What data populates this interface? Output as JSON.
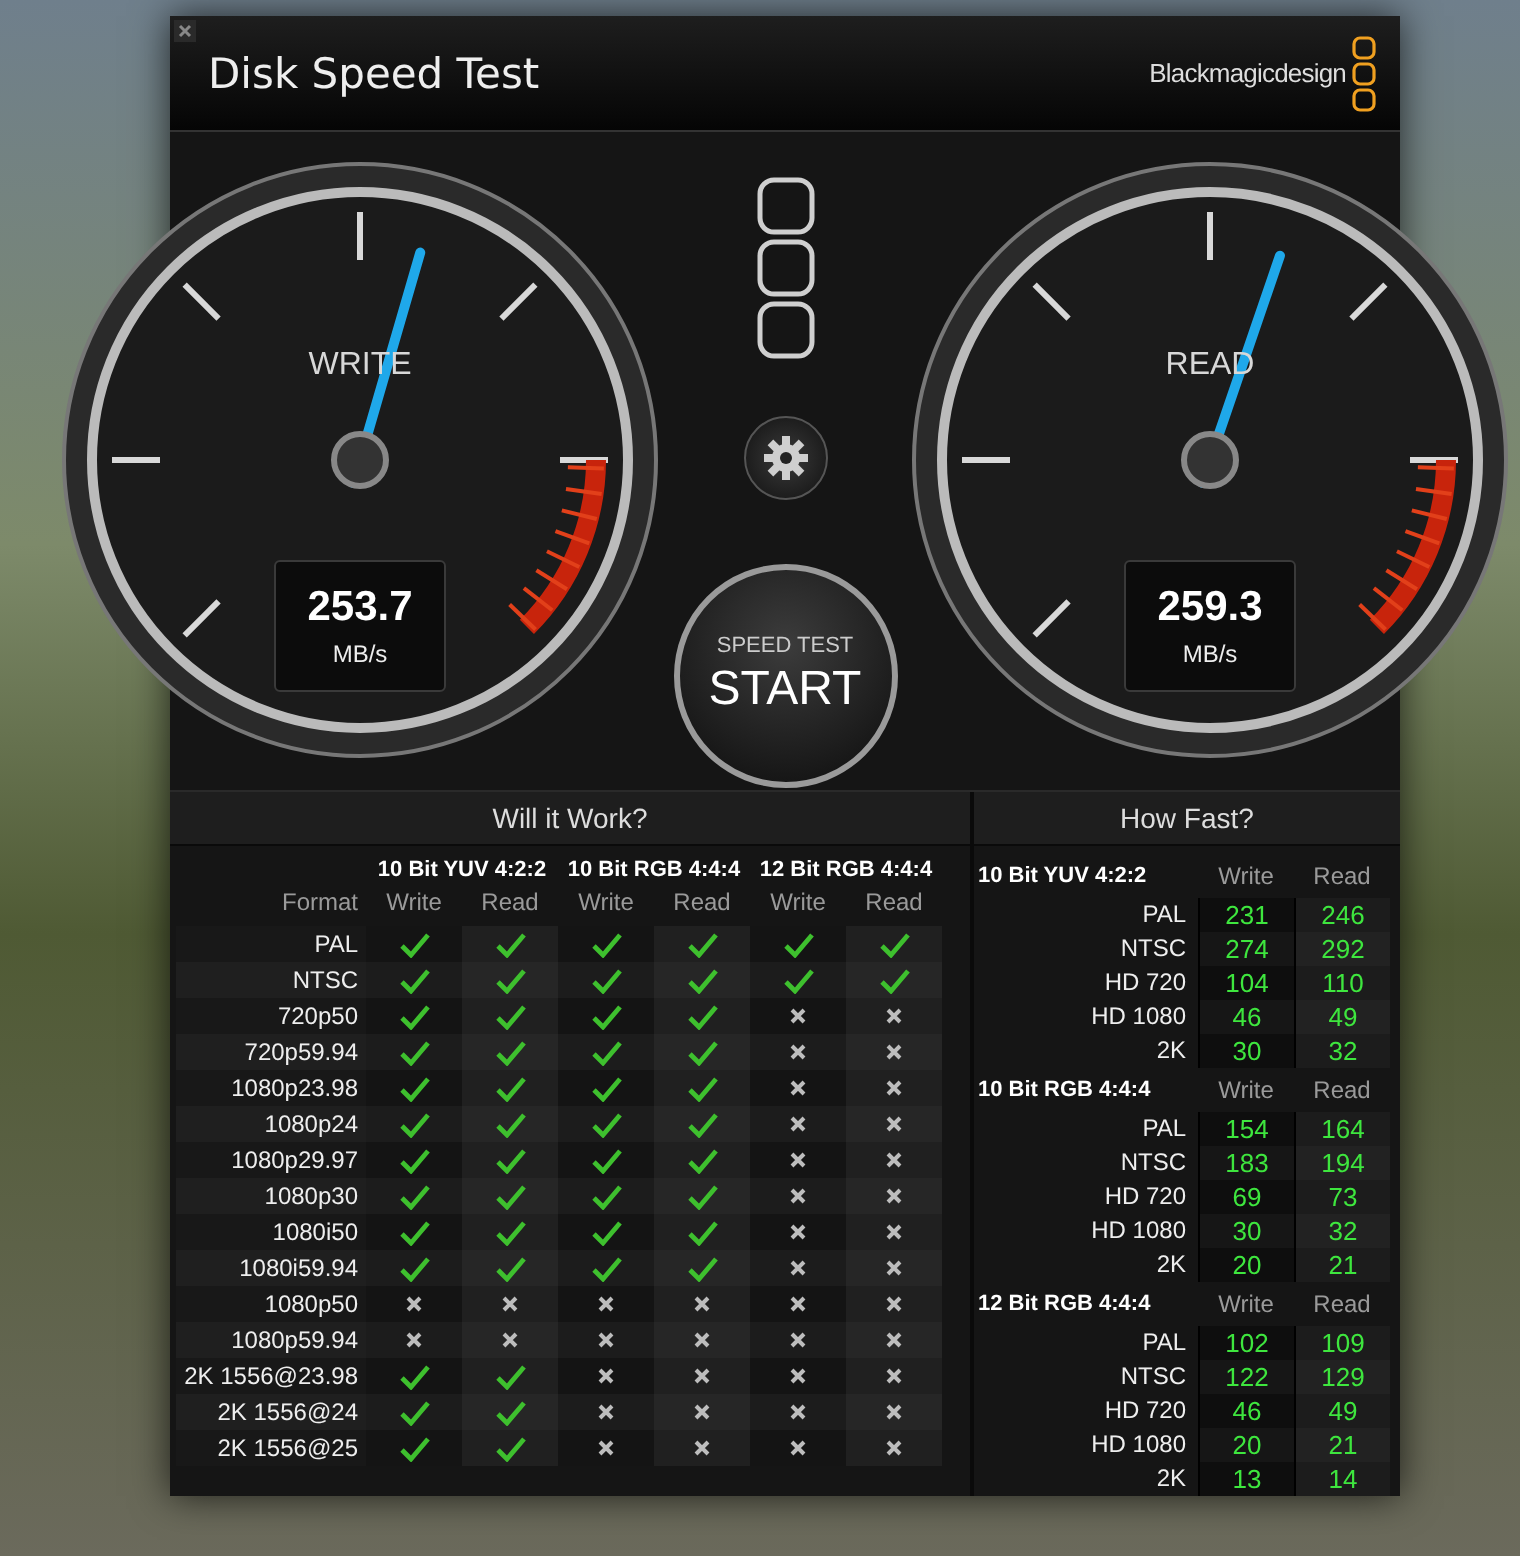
{
  "window": {
    "title": "Disk Speed Test",
    "brand": "Blackmagicdesign"
  },
  "gauges": [
    {
      "label": "WRITE",
      "value": "253.7",
      "unit": "MB/s",
      "level": 0.56
    },
    {
      "label": "READ",
      "value": "259.3",
      "unit": "MB/s",
      "level": 0.57
    }
  ],
  "start_button": {
    "caption": "SPEED TEST",
    "label": "START"
  },
  "will_it_work": {
    "title": "Will it Work?",
    "groups": [
      "10 Bit YUV 4:2:2",
      "10 Bit RGB 4:4:4",
      "12 Bit RGB 4:4:4"
    ],
    "columns": [
      "Format",
      "Write",
      "Read",
      "Write",
      "Read",
      "Write",
      "Read"
    ],
    "rows": [
      {
        "format": "PAL",
        "results": [
          true,
          true,
          true,
          true,
          true,
          true
        ]
      },
      {
        "format": "NTSC",
        "results": [
          true,
          true,
          true,
          true,
          true,
          true
        ]
      },
      {
        "format": "720p50",
        "results": [
          true,
          true,
          true,
          true,
          false,
          false
        ]
      },
      {
        "format": "720p59.94",
        "results": [
          true,
          true,
          true,
          true,
          false,
          false
        ]
      },
      {
        "format": "1080p23.98",
        "results": [
          true,
          true,
          true,
          true,
          false,
          false
        ]
      },
      {
        "format": "1080p24",
        "results": [
          true,
          true,
          true,
          true,
          false,
          false
        ]
      },
      {
        "format": "1080p29.97",
        "results": [
          true,
          true,
          true,
          true,
          false,
          false
        ]
      },
      {
        "format": "1080p30",
        "results": [
          true,
          true,
          true,
          true,
          false,
          false
        ]
      },
      {
        "format": "1080i50",
        "results": [
          true,
          true,
          true,
          true,
          false,
          false
        ]
      },
      {
        "format": "1080i59.94",
        "results": [
          true,
          true,
          true,
          true,
          false,
          false
        ]
      },
      {
        "format": "1080p50",
        "results": [
          false,
          false,
          false,
          false,
          false,
          false
        ]
      },
      {
        "format": "1080p59.94",
        "results": [
          false,
          false,
          false,
          false,
          false,
          false
        ]
      },
      {
        "format": "2K 1556@23.98",
        "results": [
          true,
          true,
          false,
          false,
          false,
          false
        ]
      },
      {
        "format": "2K 1556@24",
        "results": [
          true,
          true,
          false,
          false,
          false,
          false
        ]
      },
      {
        "format": "2K 1556@25",
        "results": [
          true,
          true,
          false,
          false,
          false,
          false
        ]
      }
    ]
  },
  "how_fast": {
    "title": "How Fast?",
    "groups": [
      {
        "name": "10 Bit YUV 4:2:2",
        "columns": [
          "Write",
          "Read"
        ],
        "rows": [
          {
            "format": "PAL",
            "write": "231",
            "read": "246"
          },
          {
            "format": "NTSC",
            "write": "274",
            "read": "292"
          },
          {
            "format": "HD 720",
            "write": "104",
            "read": "110"
          },
          {
            "format": "HD 1080",
            "write": "46",
            "read": "49"
          },
          {
            "format": "2K",
            "write": "30",
            "read": "32"
          }
        ]
      },
      {
        "name": "10 Bit RGB 4:4:4",
        "columns": [
          "Write",
          "Read"
        ],
        "rows": [
          {
            "format": "PAL",
            "write": "154",
            "read": "164"
          },
          {
            "format": "NTSC",
            "write": "183",
            "read": "194"
          },
          {
            "format": "HD 720",
            "write": "69",
            "read": "73"
          },
          {
            "format": "HD 1080",
            "write": "30",
            "read": "32"
          },
          {
            "format": "2K",
            "write": "20",
            "read": "21"
          }
        ]
      },
      {
        "name": "12 Bit RGB 4:4:4",
        "columns": [
          "Write",
          "Read"
        ],
        "rows": [
          {
            "format": "PAL",
            "write": "102",
            "read": "109"
          },
          {
            "format": "NTSC",
            "write": "122",
            "read": "129"
          },
          {
            "format": "HD 720",
            "write": "46",
            "read": "49"
          },
          {
            "format": "HD 1080",
            "write": "20",
            "read": "21"
          },
          {
            "format": "2K",
            "write": "13",
            "read": "14"
          }
        ]
      }
    ]
  }
}
